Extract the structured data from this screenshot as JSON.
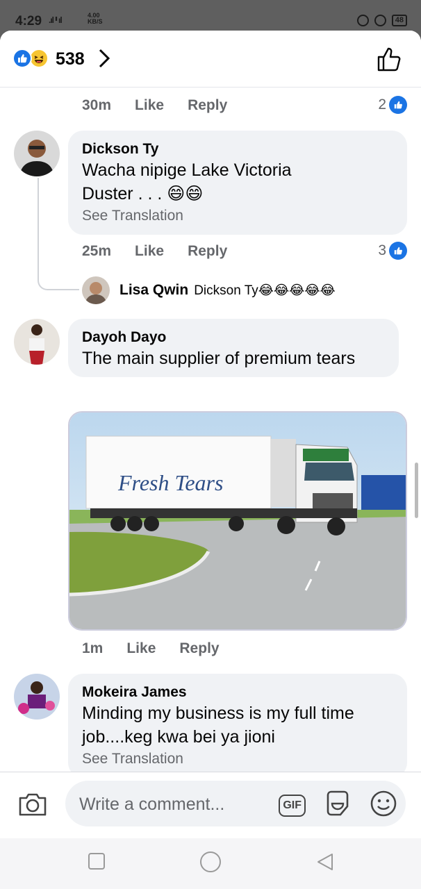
{
  "status_bar": {
    "time": "4:29",
    "network": "4G",
    "speed_value": "4.00",
    "speed_unit": "KB/S",
    "battery": "48"
  },
  "reactions": {
    "count": "538",
    "icons": [
      "like-icon",
      "haha-icon"
    ]
  },
  "top_meta": {
    "time": "30m",
    "like": "Like",
    "reply": "Reply",
    "likes": "2"
  },
  "comments": [
    {
      "name": "Dickson Ty",
      "text_line1": "Wacha nipige Lake Victoria",
      "text_line2": "Duster . . . 😄😄",
      "translate": "See Translation",
      "time": "25m",
      "like": "Like",
      "reply": "Reply",
      "likes": "3",
      "reply_preview": {
        "name": "Lisa Qwin",
        "text": "Dickson Ty😂😂😂😂😂"
      }
    },
    {
      "name": "Dayoh Dayo",
      "text": "The main supplier of premium tears",
      "image_caption": "Fresh Tears",
      "time": "1m",
      "like": "Like",
      "reply": "Reply"
    },
    {
      "name": "Mokeira James",
      "text_line1": "Minding my business is my full time",
      "text_line2": "job....keg kwa bei ya jioni",
      "translate": "See Translation"
    }
  ],
  "composer": {
    "placeholder": "Write a comment...",
    "gif": "GIF"
  },
  "colors": {
    "accent": "#1b74e4",
    "bubble": "#f0f2f5",
    "meta_text": "#65676b"
  }
}
